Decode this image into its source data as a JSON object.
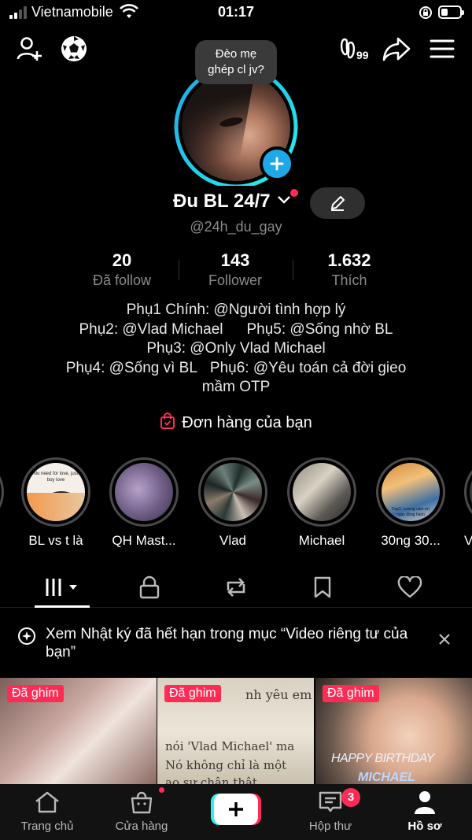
{
  "status_bar": {
    "carrier": "Vietnamobile",
    "time": "01:17",
    "battery_level": 0.3
  },
  "tooltip": {
    "line1": "Đèo mẹ",
    "line2": "ghép cl jv?"
  },
  "profile": {
    "display_name": "Đu BL 24/7",
    "handle": "@24h_du_gay",
    "stats": [
      {
        "value": "20",
        "label": "Đã follow"
      },
      {
        "value": "143",
        "label": "Follower"
      },
      {
        "value": "1.632",
        "label": "Thích"
      }
    ],
    "bio": {
      "line1": "Phụ1 Chính: @Người tình hợp lý",
      "line2a": "Phụ2: @Vlad Michael",
      "line2b": "Phụ5: @Sống nhờ BL",
      "line3": "Phụ3: @Only Vlad Michael",
      "line4a": "Phụ4: @Sống vì BL",
      "line4b": "Phụ6: @Yêu toán cả đời gieo",
      "line5": "mầm OTP"
    },
    "orders_label": "Đơn hàng của bạn"
  },
  "highlights": [
    {
      "caption": "BL vs t là",
      "overlay_text": "No need for love, just boy love"
    },
    {
      "caption": "QH Mast..."
    },
    {
      "caption": "Vlad"
    },
    {
      "caption": "Michael"
    },
    {
      "caption": "30ng 30...",
      "overlay_text": "Day1: Lương cảm ơn ngày đồng hành"
    },
    {
      "caption": "V"
    }
  ],
  "notice": {
    "text": "Xem Nhật ký đã hết hạn trong mục “Video riêng tư của bạn”"
  },
  "videos": [
    {
      "pinned_label": "Đã ghim"
    },
    {
      "pinned_label": "Đã ghim",
      "overlay_line1": "nh yêu em",
      "overlay_line2": "nói 'Vlad Michael' ma",
      "overlay_line3": "Nó không chỉ là một",
      "overlay_line4": "ao sư chân thật"
    },
    {
      "pinned_label": "Đã ghim",
      "overlay_line1": "HAPPY BIRTHDAY",
      "overlay_line2": "MICHAEL"
    }
  ],
  "bottom_nav": [
    {
      "label": "Trang chủ"
    },
    {
      "label": "Cửa hàng"
    },
    {
      "label": ""
    },
    {
      "label": "Hộp thư",
      "badge": "3"
    },
    {
      "label": "Hồ sơ"
    }
  ],
  "colors": {
    "accent": "#fe2c55",
    "cyan": "#25f4ee",
    "blue": "#1fa8e8"
  }
}
